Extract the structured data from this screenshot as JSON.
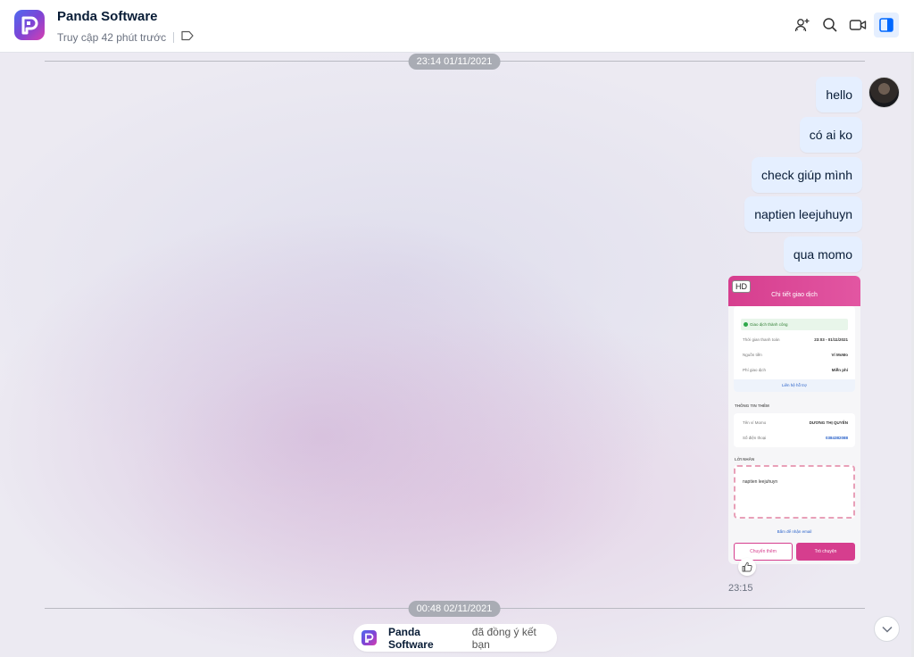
{
  "header": {
    "title": "Panda Software",
    "status": "Truy cập 42 phút trước",
    "icons": [
      "add-member-icon",
      "search-icon",
      "video-call-icon",
      "sidebar-toggle-icon"
    ]
  },
  "chat": {
    "date_separators": [
      "23:14 01/11/2021",
      "00:48 02/11/2021"
    ],
    "messages": [
      "hello",
      "có ai ko",
      "check giúp mình",
      "naptien leejuhuyn",
      "qua momo"
    ],
    "image_message": {
      "badge": "HD",
      "time": "23:15",
      "screenshot": {
        "title": "Chi tiết giao dịch",
        "status": "Giao dịch thành công",
        "rows": [
          {
            "label": "Thời gian thanh toán",
            "value": "23:03 - 01/11/2021"
          },
          {
            "label": "Nguồn tiền",
            "value": "Ví MoMo"
          },
          {
            "label": "Phí giao dịch",
            "value": "Miễn phí"
          }
        ],
        "contact": "Liên hệ hỗ trợ",
        "more_title": "THÔNG TIN THÊM",
        "more_rows": [
          {
            "label": "Tên ví Momo",
            "value": "DƯƠNG THỊ QUYÊN"
          },
          {
            "label": "Số điện thoại",
            "value": "0384382088"
          }
        ],
        "note_title": "LỜI NHẮN",
        "note": "naptien leejuhuyn",
        "email_hint": "Bấm để nhận email",
        "btn_secondary": "Chuyển thêm",
        "btn_primary": "Trò chuyện"
      }
    },
    "notice": {
      "name": "Panda Software",
      "text": "đã đồng ý kết bạn"
    }
  },
  "colors": {
    "accent": "#0068ff",
    "bubble": "#e5efff",
    "momo": "#d63e8e"
  }
}
